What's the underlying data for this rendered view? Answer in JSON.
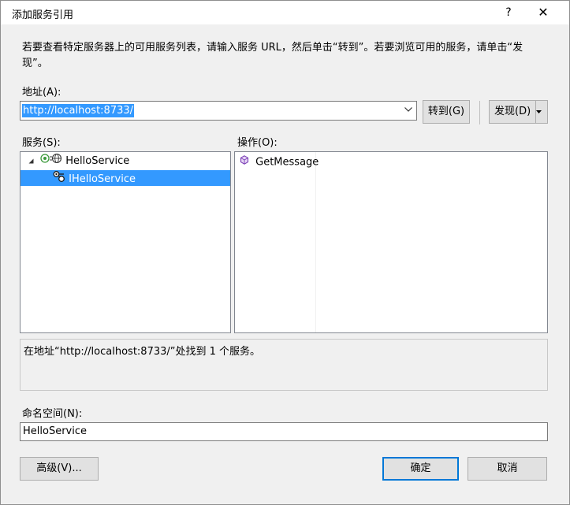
{
  "window": {
    "title": "添加服务引用",
    "help_glyph": "?",
    "close_glyph": "✕"
  },
  "description": "若要查看特定服务器上的可用服务列表，请输入服务 URL，然后单击“转到”。若要浏览可用的服务，请单击“发现”。",
  "address": {
    "label": "地址(A):",
    "value": "http://localhost:8733/",
    "go_label": "转到(G)",
    "discover_label": "发现(D)"
  },
  "services": {
    "label": "服务(S):",
    "items": [
      {
        "label": "HelloService",
        "expanded": true,
        "icon": "service-icon"
      },
      {
        "label": "IHelloService",
        "selected": true,
        "icon": "contract-icon"
      }
    ]
  },
  "operations": {
    "label": "操作(O):",
    "items": [
      {
        "label": "GetMessage",
        "icon": "operation-icon"
      }
    ]
  },
  "status_text": "在地址“http://localhost:8733/”处找到 1 个服务。",
  "namespace": {
    "label": "命名空间(N):",
    "value": "HelloService"
  },
  "buttons": {
    "advanced": "高级(V)...",
    "ok": "确定",
    "cancel": "取消"
  },
  "colors": {
    "selection": "#3399ff",
    "accent_border": "#0078d7",
    "operation_icon": "#7b3fb5"
  }
}
